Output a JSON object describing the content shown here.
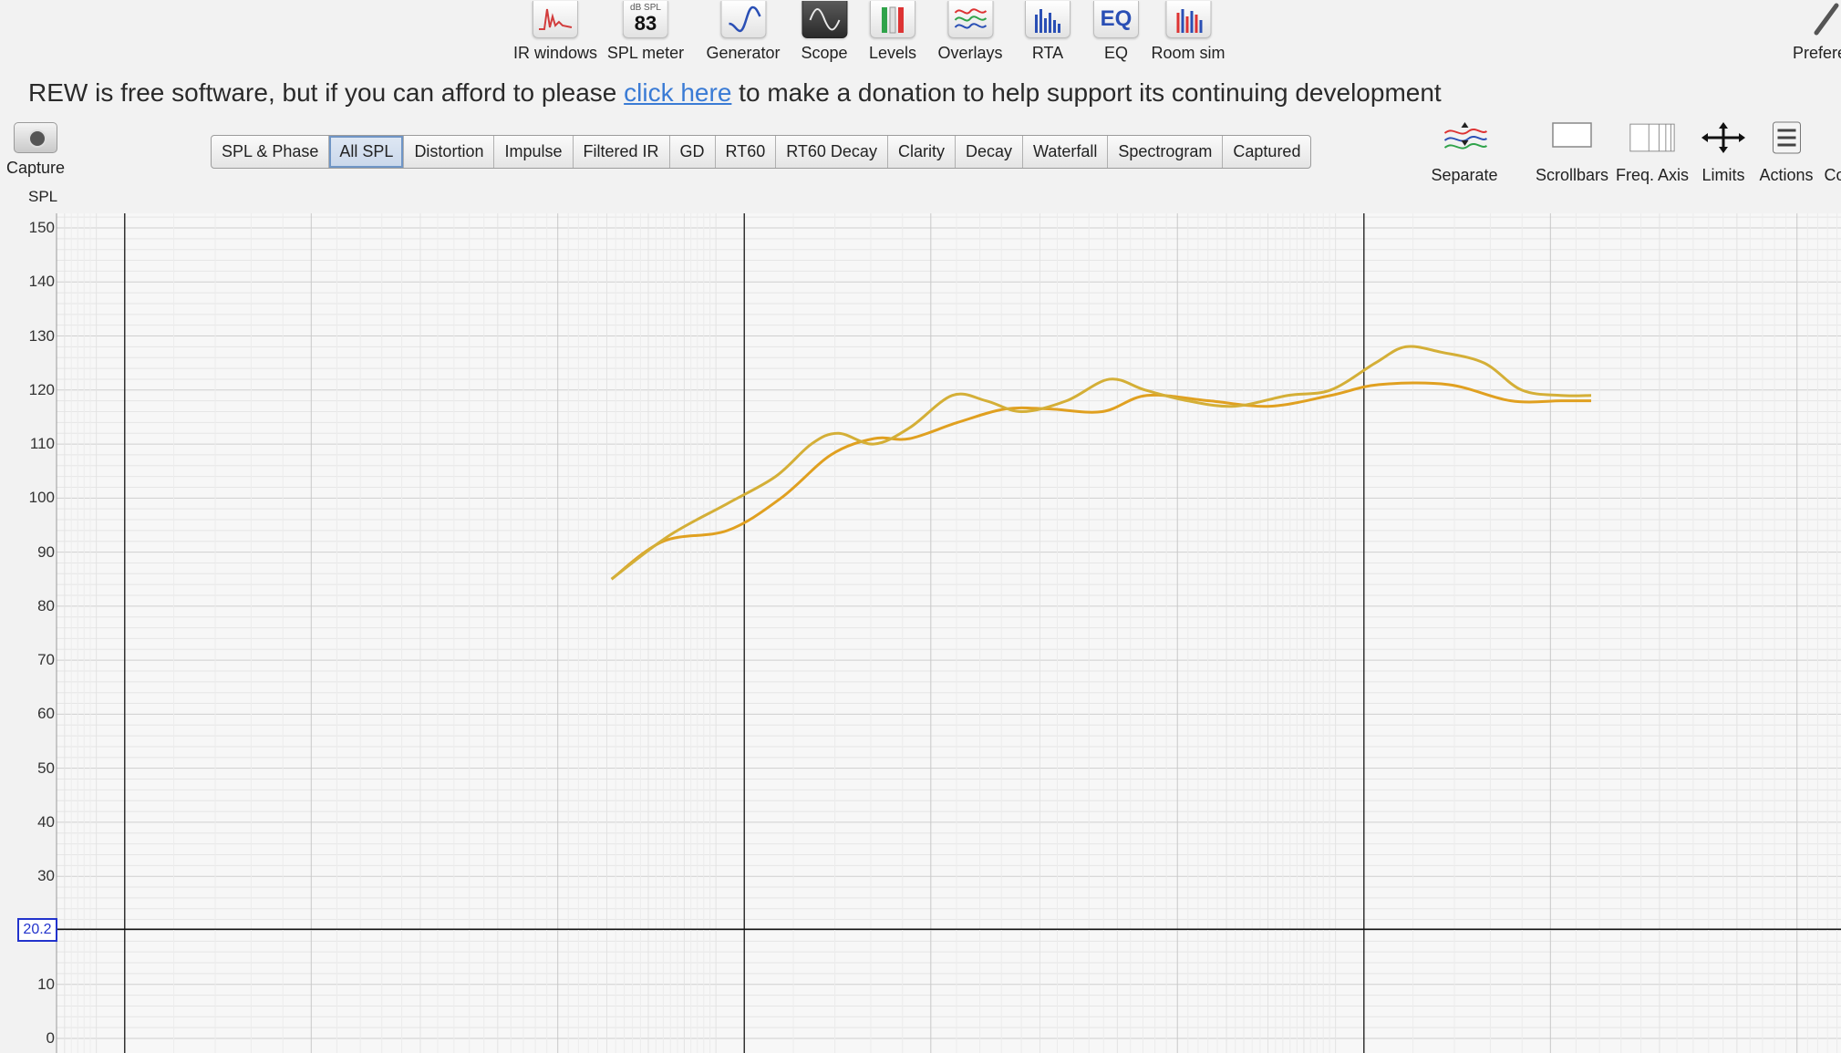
{
  "toolbar": {
    "items": [
      {
        "label": "IR windows",
        "icon": "ir-windows-icon"
      },
      {
        "label": "SPL meter",
        "icon": "spl-meter-icon",
        "icon_text_top": "dB SPL",
        "icon_text": "83"
      },
      {
        "label": "Generator",
        "icon": "generator-icon"
      },
      {
        "label": "Scope",
        "icon": "scope-icon"
      },
      {
        "label": "Levels",
        "icon": "levels-icon"
      },
      {
        "label": "Overlays",
        "icon": "overlays-icon"
      },
      {
        "label": "RTA",
        "icon": "rta-icon"
      },
      {
        "label": "EQ",
        "icon": "eq-icon",
        "icon_text": "EQ"
      },
      {
        "label": "Room sim",
        "icon": "room-sim-icon"
      },
      {
        "label": "Prefere",
        "icon": "preferences-icon"
      }
    ]
  },
  "banner": {
    "before": "REW is free software, but if you can afford to please ",
    "link": "click here",
    "after": " to make a donation to help support its continuing development"
  },
  "capture": {
    "label": "Capture"
  },
  "tabs": [
    "SPL & Phase",
    "All SPL",
    "Distortion",
    "Impulse",
    "Filtered IR",
    "GD",
    "RT60",
    "RT60 Decay",
    "Clarity",
    "Decay",
    "Waterfall",
    "Spectrogram",
    "Captured"
  ],
  "active_tab": "All SPL",
  "graph_tools": [
    {
      "label": "Separate",
      "icon": "separate-icon"
    },
    {
      "label": "Scrollbars",
      "icon": "scrollbars-icon"
    },
    {
      "label": "Freq. Axis",
      "icon": "freq-axis-icon"
    },
    {
      "label": "Limits",
      "icon": "limits-icon"
    },
    {
      "label": "Actions",
      "icon": "actions-icon"
    },
    {
      "label": "Co",
      "icon": "controls-icon"
    }
  ],
  "graph": {
    "y_axis_label": "SPL",
    "cursor_value": "20.2"
  },
  "colors": {
    "background": "#f2f2f2",
    "link": "#3a7bd5",
    "trace_1": "#e0a020",
    "trace_2": "#d4af37",
    "cursor": "#2233cc"
  },
  "chart_data": {
    "type": "line",
    "ylabel": "SPL",
    "ylim": [
      0,
      150
    ],
    "y_ticks": [
      0,
      10,
      30,
      40,
      50,
      60,
      70,
      80,
      90,
      100,
      110,
      120,
      130,
      140,
      150
    ],
    "x_scale": "log",
    "cursor_y": 20.2,
    "grid": true,
    "series": [
      {
        "color": "#e0a020",
        "points": [
          [
            0.311,
            85
          ],
          [
            0.34,
            92
          ],
          [
            0.376,
            94
          ],
          [
            0.406,
            100
          ],
          [
            0.434,
            108
          ],
          [
            0.458,
            111
          ],
          [
            0.478,
            111
          ],
          [
            0.505,
            114
          ],
          [
            0.532,
            116.5
          ],
          [
            0.556,
            116.5
          ],
          [
            0.586,
            116
          ],
          [
            0.611,
            119
          ],
          [
            0.646,
            118
          ],
          [
            0.68,
            117
          ],
          [
            0.714,
            119
          ],
          [
            0.741,
            121
          ],
          [
            0.78,
            121
          ],
          [
            0.815,
            118
          ],
          [
            0.843,
            118
          ],
          [
            0.86,
            118
          ]
        ]
      },
      {
        "color": "#d4af37",
        "points": [
          [
            0.311,
            85
          ],
          [
            0.343,
            93
          ],
          [
            0.376,
            99
          ],
          [
            0.403,
            104
          ],
          [
            0.423,
            110
          ],
          [
            0.438,
            112
          ],
          [
            0.458,
            110
          ],
          [
            0.478,
            113
          ],
          [
            0.502,
            119
          ],
          [
            0.521,
            118
          ],
          [
            0.541,
            116
          ],
          [
            0.566,
            118
          ],
          [
            0.59,
            122
          ],
          [
            0.61,
            120
          ],
          [
            0.634,
            118
          ],
          [
            0.66,
            117
          ],
          [
            0.69,
            119
          ],
          [
            0.714,
            120
          ],
          [
            0.739,
            125
          ],
          [
            0.756,
            128
          ],
          [
            0.776,
            127
          ],
          [
            0.8,
            125
          ],
          [
            0.821,
            120
          ],
          [
            0.843,
            119
          ],
          [
            0.86,
            119
          ]
        ]
      }
    ]
  }
}
